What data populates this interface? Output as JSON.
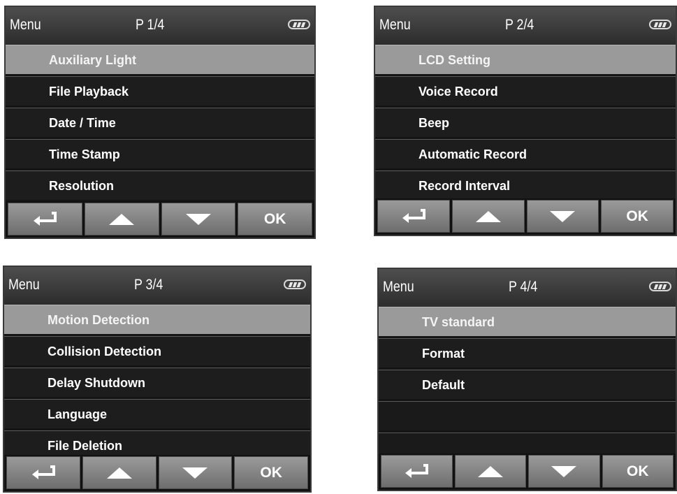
{
  "menu_label": "Menu",
  "buttons": {
    "back_icon": "return-arrow",
    "up_icon": "triangle-up",
    "down_icon": "triangle-down",
    "ok_label": "OK"
  },
  "screens": [
    {
      "page": "P 1/4",
      "items": [
        "Auxiliary Light",
        "File Playback",
        "Date / Time",
        "Time Stamp",
        "Resolution"
      ]
    },
    {
      "page": "P 2/4",
      "items": [
        "LCD Setting",
        "Voice Record",
        "Beep",
        "Automatic Record",
        "Record Interval"
      ]
    },
    {
      "page": "P 3/4",
      "items": [
        "Motion Detection",
        "Collision Detection",
        "Delay Shutdown",
        "Language",
        "File Deletion"
      ]
    },
    {
      "page": "P 4/4",
      "items": [
        "TV standard",
        "Format",
        "Default",
        "",
        ""
      ]
    }
  ],
  "colors": {
    "selected_row": "#9a9a9a",
    "row": "#1d1d1d",
    "header": "#3c3c3c",
    "button": "#8a8a8a"
  }
}
